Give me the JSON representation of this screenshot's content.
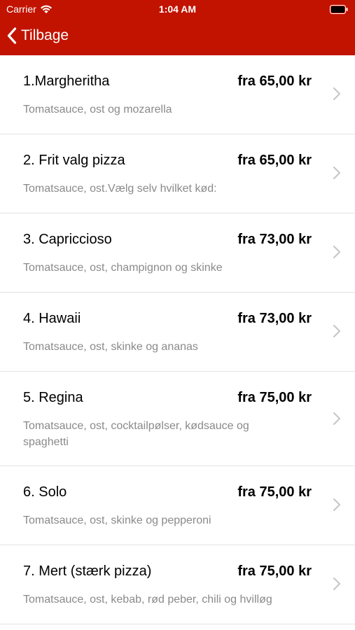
{
  "status_bar": {
    "carrier": "Carrier",
    "time": "1:04 AM"
  },
  "nav": {
    "back_label": "Tilbage",
    "accent_color": "#c21300"
  },
  "items": [
    {
      "name": "1.Margheritha",
      "price": "fra 65,00 kr",
      "description": "Tomatsauce, ost og mozarella"
    },
    {
      "name": "2. Frit valg pizza",
      "price": "fra 65,00 kr",
      "description": "Tomatsauce, ost.Vælg selv hvilket kød:"
    },
    {
      "name": "3. Capriccioso",
      "price": "fra 73,00 kr",
      "description": "Tomatsauce, ost, champignon og skinke"
    },
    {
      "name": "4. Hawaii",
      "price": "fra 73,00 kr",
      "description": "Tomatsauce, ost, skinke og ananas"
    },
    {
      "name": "5. Regina",
      "price": "fra 75,00 kr",
      "description": "Tomatsauce, ost, cocktailpølser, kødsauce og spaghetti"
    },
    {
      "name": "6. Solo",
      "price": "fra 75,00 kr",
      "description": "Tomatsauce, ost, skinke og pepperoni"
    },
    {
      "name": "7. Mert (stærk pizza)",
      "price": "fra 75,00 kr",
      "description": "Tomatsauce, ost, kebab, rød peber, chili og hvilløg"
    }
  ],
  "icons": {
    "wifi": "wifi-icon",
    "battery": "battery-icon",
    "back": "chevron-left-icon",
    "row_disclosure": "chevron-right-icon"
  }
}
